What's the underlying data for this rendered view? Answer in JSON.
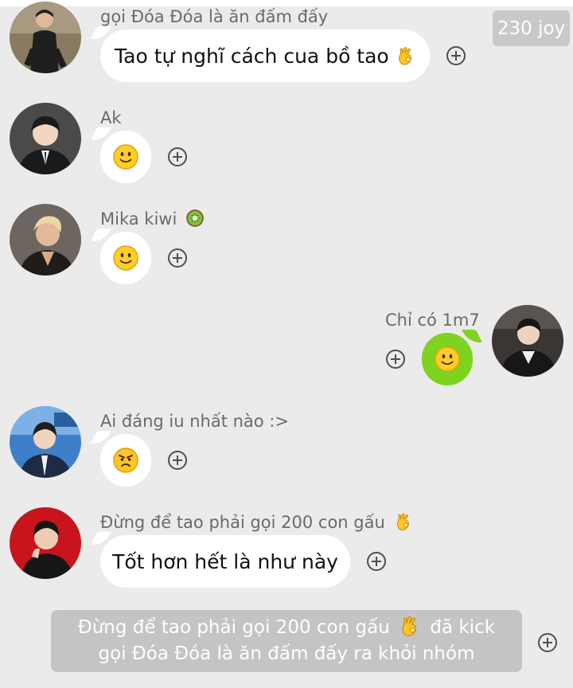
{
  "badge": {
    "label": "230 joy"
  },
  "messages": [
    {
      "sender": "gọi Đóa Đóa là ăn đấm đấy",
      "text": "Tao tự nghĩ cách cua bồ tao",
      "emoji": "ok-hand-emoji"
    },
    {
      "sender": "Ak",
      "emoji": "slight-smile-emoji"
    },
    {
      "sender": "Mika kiwi",
      "sender_emoji": "kiwi-emoji",
      "emoji": "slight-smile-emoji"
    },
    {
      "sender": "Chỉ có 1m7",
      "emoji": "slight-smile-emoji",
      "own": true
    },
    {
      "sender": "Ai đáng iu nhất nào :>",
      "emoji": "angry-face-emoji"
    },
    {
      "sender": "Đừng để tao phải gọi 200 con gấu",
      "sender_emoji": "ok-hand-emoji",
      "text": "Tốt hơn hết là như này"
    }
  ],
  "system_notice": {
    "line1_before": "Đừng để tao phải gọi 200 con gấu",
    "line1_after": "đã kick",
    "line2": "gọi Đóa Đóa là ăn đấm đấy ra khỏi nhóm",
    "emoji": "ok-hand-emoji"
  },
  "colors": {
    "background": "#ebebeb",
    "bubble": "#ffffff",
    "own_bubble": "#7ed321",
    "system_bg": "#c4c4c4",
    "emoji_yellow": "#ffc928"
  }
}
